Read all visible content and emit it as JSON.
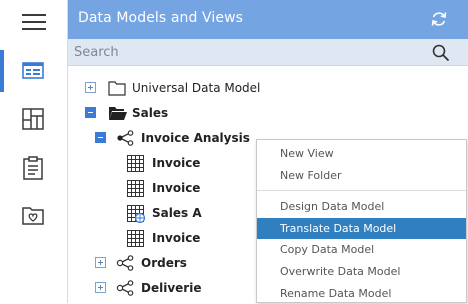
{
  "rail": {
    "items": [
      {
        "name": "menu-hamburger",
        "active": false
      },
      {
        "name": "data-models",
        "active": true
      },
      {
        "name": "dashboards",
        "active": false
      },
      {
        "name": "reports",
        "active": false
      },
      {
        "name": "favorites",
        "active": false
      }
    ]
  },
  "header": {
    "title": "Data Models and Views",
    "refresh_icon": "refresh-icon"
  },
  "search": {
    "placeholder": "Search",
    "icon": "search-icon"
  },
  "tree": {
    "items": [
      {
        "label": "Universal Data Model",
        "bold": false,
        "expander": "plus",
        "icon": "folder-icon"
      },
      {
        "label": "Sales",
        "bold": true,
        "expander": "minus",
        "icon": "folder-open-icon"
      },
      {
        "label": "Invoice Analysis",
        "bold": true,
        "expander": "minus",
        "icon": "share-icon"
      },
      {
        "label": "Invoice",
        "bold": true,
        "expander": "none",
        "icon": "table-icon"
      },
      {
        "label": "Invoice",
        "bold": true,
        "expander": "none",
        "icon": "table-icon"
      },
      {
        "label": "Sales A",
        "bold": true,
        "expander": "none",
        "icon": "table-globe-icon"
      },
      {
        "label": "Invoice",
        "bold": true,
        "expander": "none",
        "icon": "table-icon"
      },
      {
        "label": "Orders",
        "bold": true,
        "expander": "plus",
        "icon": "share-icon"
      },
      {
        "label": "Deliverie",
        "bold": true,
        "expander": "plus",
        "icon": "share-icon"
      }
    ]
  },
  "context_menu": {
    "items": [
      {
        "label": "New View"
      },
      {
        "label": "New Folder"
      },
      {
        "label": "Design Data Model"
      },
      {
        "label": "Translate Data Model",
        "selected": true
      },
      {
        "label": "Copy Data Model"
      },
      {
        "label": "Overwrite Data Model"
      },
      {
        "label": "Rename Data Model"
      }
    ]
  },
  "colors": {
    "header_bg": "#74a4e2",
    "search_bg": "#dfe7f2",
    "menu_selected": "#2f7fc1",
    "active_indicator": "#3a7bd5"
  }
}
